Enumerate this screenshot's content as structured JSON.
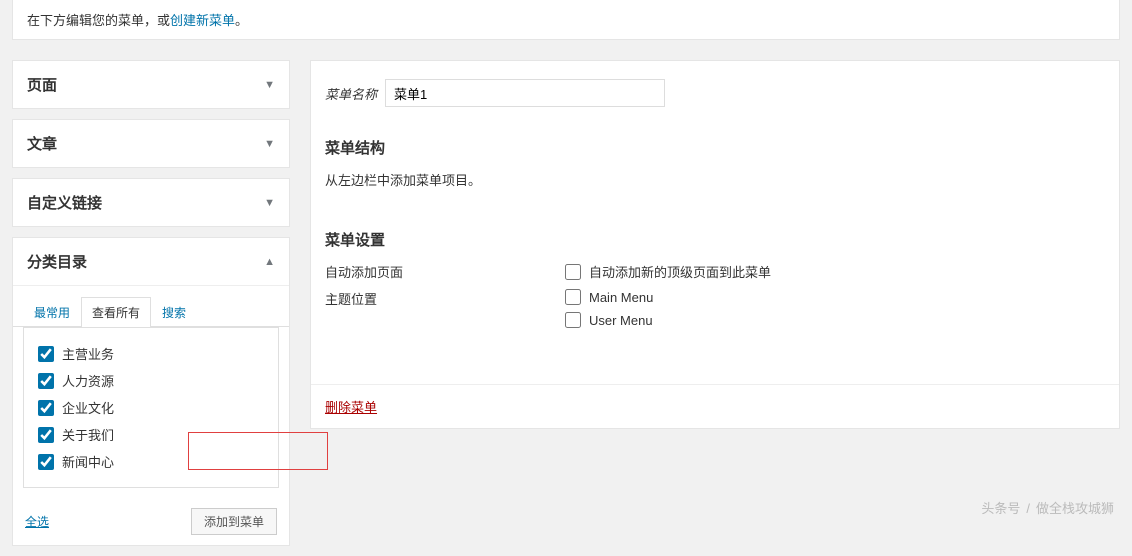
{
  "intro": {
    "prefix": "在下方编辑您的菜单，或",
    "link": "创建新菜单",
    "suffix": "。"
  },
  "panels": {
    "pages": "页面",
    "posts": "文章",
    "custom": "自定义链接",
    "categories": "分类目录"
  },
  "tabs": {
    "freq": "最常用",
    "all": "查看所有",
    "search": "搜索"
  },
  "cats": [
    "主营业务",
    "人力资源",
    "企业文化",
    "关于我们",
    "新闻中心"
  ],
  "sel_all": "全选",
  "add_btn": "添加到菜单",
  "menu_name_label": "菜单名称",
  "menu_name_value": "菜单1",
  "structure_title": "菜单结构",
  "structure_hint": "从左边栏中添加菜单项目。",
  "settings_title": "菜单设置",
  "auto_add_label": "自动添加页面",
  "auto_add_opt": "自动添加新的顶级页面到此菜单",
  "theme_loc_label": "主题位置",
  "loc1": "Main Menu",
  "loc2": "User Menu",
  "delete_menu": "删除菜单",
  "watermark": {
    "a": "头条号",
    "b": "做全栈攻城狮"
  }
}
